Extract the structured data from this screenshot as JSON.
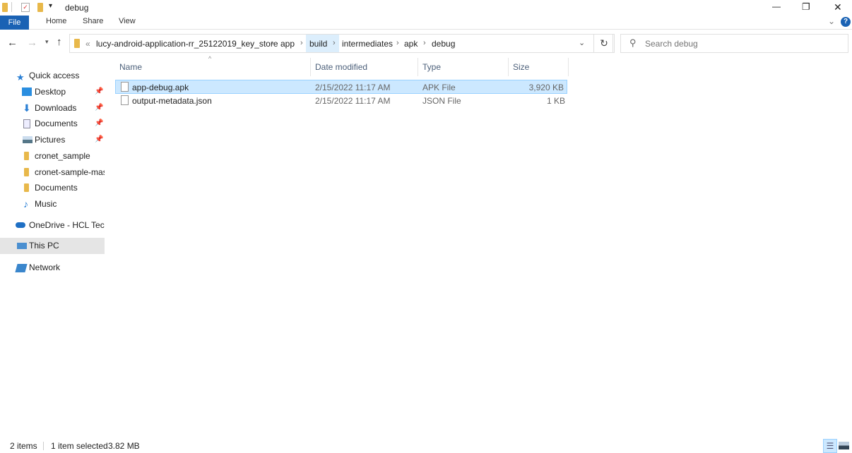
{
  "window": {
    "title": "debug",
    "minimize": "—",
    "maximize": "❐",
    "close": "✕"
  },
  "ribbon": {
    "tabs": [
      "File",
      "Home",
      "Share",
      "View"
    ]
  },
  "address": {
    "overflow": "«",
    "crumbs": [
      "lucy-android-application-rr_25122019_key_store",
      "app",
      "build",
      "intermediates",
      "apk",
      "debug"
    ]
  },
  "search": {
    "placeholder": "Search debug"
  },
  "nav": {
    "items": [
      {
        "label": "Quick access",
        "icon": "star-icon",
        "pinned": false
      },
      {
        "label": "Desktop",
        "icon": "desktop-icon",
        "pinned": true
      },
      {
        "label": "Downloads",
        "icon": "download-icon",
        "pinned": true
      },
      {
        "label": "Documents",
        "icon": "documents-icon",
        "pinned": true
      },
      {
        "label": "Pictures",
        "icon": "pictures-icon",
        "pinned": true
      },
      {
        "label": "cronet_sample",
        "icon": "folder-icon",
        "pinned": false
      },
      {
        "label": "cronet-sample-mast",
        "icon": "folder-icon",
        "pinned": false
      },
      {
        "label": "Documents",
        "icon": "folder-icon",
        "pinned": false
      },
      {
        "label": "Music",
        "icon": "music-icon",
        "pinned": false
      },
      {
        "label": "OneDrive - HCL Techr",
        "icon": "cloud-icon",
        "pinned": false
      },
      {
        "label": "This PC",
        "icon": "pc-icon",
        "pinned": false
      },
      {
        "label": "Network",
        "icon": "network-icon",
        "pinned": false
      }
    ]
  },
  "columns": [
    "Name",
    "Date modified",
    "Type",
    "Size"
  ],
  "files": [
    {
      "name": "app-debug.apk",
      "date": "2/15/2022 11:17 AM",
      "type": "APK File",
      "size": "3,920 KB",
      "selected": true
    },
    {
      "name": "output-metadata.json",
      "date": "2/15/2022 11:17 AM",
      "type": "JSON File",
      "size": "1 KB",
      "selected": false
    }
  ],
  "status": {
    "count": "2 items",
    "selected": "1 item selected",
    "size": "3.82 MB"
  },
  "colors": {
    "accent": "#1a62b4",
    "selection": "#cce8ff",
    "hover": "#e5e5e5"
  }
}
